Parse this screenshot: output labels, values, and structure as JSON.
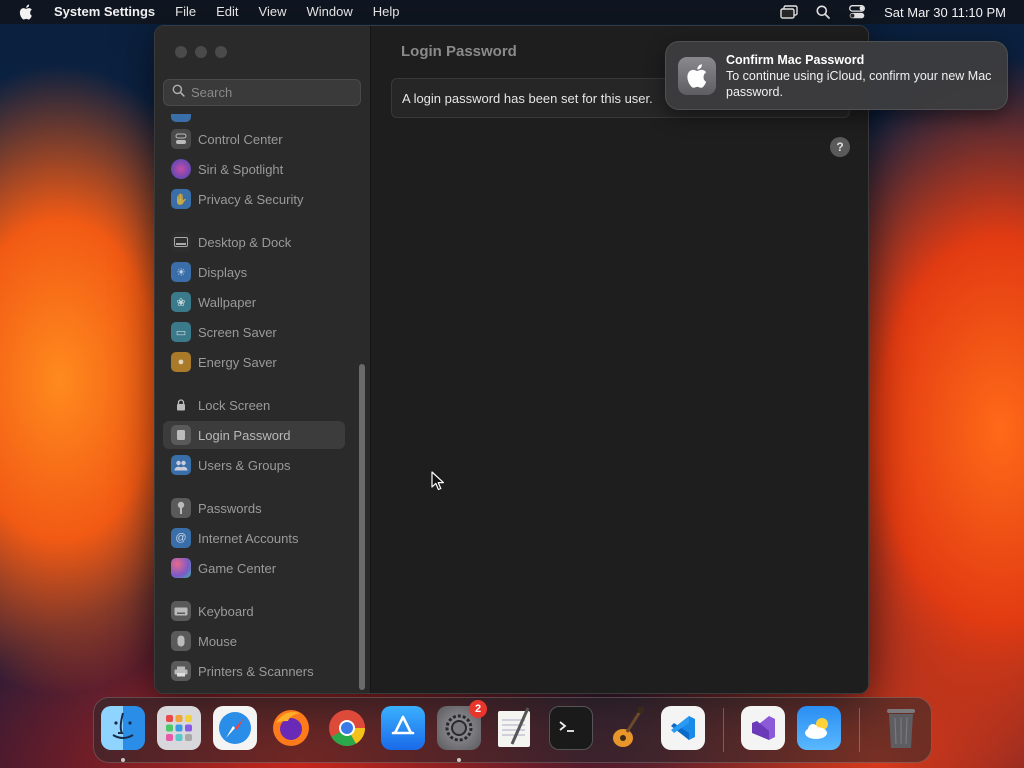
{
  "menubar": {
    "app_name": "System Settings",
    "menus": [
      "File",
      "Edit",
      "View",
      "Window",
      "Help"
    ],
    "clock": "Sat Mar 30  11:10 PM",
    "status_icons": [
      "screen-mirroring-icon",
      "spotlight-search-icon",
      "control-center-icon"
    ]
  },
  "window": {
    "search": {
      "placeholder": "Search",
      "value": ""
    },
    "sidebar": {
      "items": [
        {
          "label": "Control Center",
          "icon": "control-center-icon",
          "color": "#4a4a4a",
          "selected": false
        },
        {
          "label": "Siri & Spotlight",
          "icon": "siri-icon",
          "color": "#7a3a8a",
          "selected": false
        },
        {
          "label": "Privacy & Security",
          "icon": "hand-icon",
          "color": "#3a6ea8",
          "selected": false
        },
        {
          "label": "Desktop & Dock",
          "icon": "dock-icon",
          "color": "#3a3a3a",
          "selected": false
        },
        {
          "label": "Displays",
          "icon": "sun-icon",
          "color": "#3a6ea8",
          "selected": false
        },
        {
          "label": "Wallpaper",
          "icon": "wallpaper-icon",
          "color": "#3a7a8a",
          "selected": false
        },
        {
          "label": "Screen Saver",
          "icon": "screen-saver-icon",
          "color": "#3a7a8a",
          "selected": false
        },
        {
          "label": "Energy Saver",
          "icon": "bulb-icon",
          "color": "#a87a2a",
          "selected": false
        },
        {
          "label": "Lock Screen",
          "icon": "lock-icon",
          "color": "#2a2a2a",
          "selected": false
        },
        {
          "label": "Login Password",
          "icon": "password-icon",
          "color": "#5a5a5a",
          "selected": true
        },
        {
          "label": "Users & Groups",
          "icon": "users-icon",
          "color": "#3a6ea8",
          "selected": false
        },
        {
          "label": "Passwords",
          "icon": "key-icon",
          "color": "#5a5a5a",
          "selected": false
        },
        {
          "label": "Internet Accounts",
          "icon": "at-icon",
          "color": "#3a6ea8",
          "selected": false
        },
        {
          "label": "Game Center",
          "icon": "game-center-icon",
          "color": "#7a5a8a",
          "selected": false
        },
        {
          "label": "Keyboard",
          "icon": "keyboard-icon",
          "color": "#5a5a5a",
          "selected": false
        },
        {
          "label": "Mouse",
          "icon": "mouse-icon",
          "color": "#5a5a5a",
          "selected": false
        },
        {
          "label": "Printers & Scanners",
          "icon": "printer-icon",
          "color": "#5a5a5a",
          "selected": false
        }
      ]
    },
    "content": {
      "title": "Login Password",
      "message": "A login password has been set for this user.",
      "help": "?"
    }
  },
  "notification": {
    "title": "Confirm Mac Password",
    "body": "To continue using iCloud, confirm your new Mac password.",
    "icon": "apple-icon"
  },
  "dock": {
    "apps": [
      {
        "name": "Finder",
        "icon": "finder-icon",
        "running": true
      },
      {
        "name": "Launchpad",
        "icon": "launchpad-icon",
        "running": false
      },
      {
        "name": "Safari",
        "icon": "safari-icon",
        "running": false
      },
      {
        "name": "Firefox",
        "icon": "firefox-icon",
        "running": false
      },
      {
        "name": "Chrome",
        "icon": "chrome-icon",
        "running": false
      },
      {
        "name": "App Store",
        "icon": "app-store-icon",
        "running": false
      },
      {
        "name": "System Settings",
        "icon": "system-settings-icon",
        "running": true,
        "badge": "2"
      },
      {
        "name": "TextEdit",
        "icon": "textedit-icon",
        "running": false
      },
      {
        "name": "Terminal",
        "icon": "terminal-icon",
        "running": false
      },
      {
        "name": "GarageBand",
        "icon": "garageband-icon",
        "running": false
      },
      {
        "name": "Visual Studio Code",
        "icon": "vscode-icon",
        "running": false
      },
      {
        "name": "Visual Studio",
        "icon": "visual-studio-icon",
        "running": false
      },
      {
        "name": "Weather",
        "icon": "weather-icon",
        "running": false
      },
      {
        "name": "Trash",
        "icon": "trash-icon",
        "running": false
      }
    ]
  }
}
